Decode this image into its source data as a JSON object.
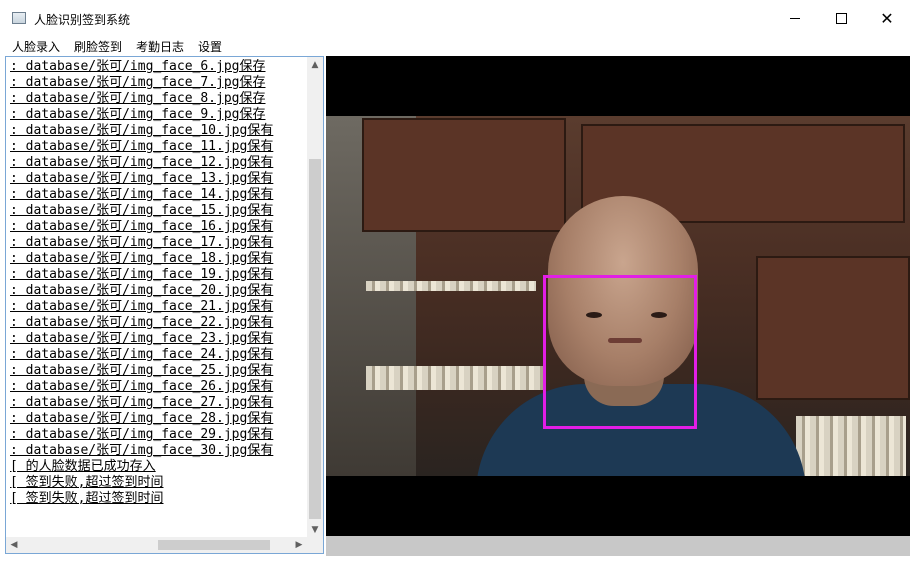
{
  "window": {
    "title": "人脸识别签到系统",
    "minimize_glyph": "",
    "maximize_glyph": "",
    "close_glyph": "✕"
  },
  "menu": {
    "items": [
      "人脸录入",
      "刷脸签到",
      "考勤日志",
      "设置"
    ]
  },
  "log": {
    "lines": [
      ": database/张可/img_face_6.jpg保存",
      ": database/张可/img_face_7.jpg保存",
      ": database/张可/img_face_8.jpg保存",
      ": database/张可/img_face_9.jpg保存",
      ": database/张可/img_face_10.jpg保有",
      ": database/张可/img_face_11.jpg保有",
      ": database/张可/img_face_12.jpg保有",
      ": database/张可/img_face_13.jpg保有",
      ": database/张可/img_face_14.jpg保有",
      ": database/张可/img_face_15.jpg保有",
      ": database/张可/img_face_16.jpg保有",
      ": database/张可/img_face_17.jpg保有",
      ": database/张可/img_face_18.jpg保有",
      ": database/张可/img_face_19.jpg保有",
      ": database/张可/img_face_20.jpg保有",
      ": database/张可/img_face_21.jpg保有",
      ": database/张可/img_face_22.jpg保有",
      ": database/张可/img_face_23.jpg保有",
      ": database/张可/img_face_24.jpg保有",
      ": database/张可/img_face_25.jpg保有",
      ": database/张可/img_face_26.jpg保有",
      ": database/张可/img_face_27.jpg保有",
      ": database/张可/img_face_28.jpg保有",
      ": database/张可/img_face_29.jpg保有",
      ": database/张可/img_face_30.jpg保有",
      "[ 的人脸数据已成功存入",
      "[ 签到失败,超过签到时间",
      "[ 签到失败,超过签到时间"
    ]
  },
  "scrollbars": {
    "up_glyph": "▲",
    "down_glyph": "▼",
    "left_glyph": "◀",
    "right_glyph": "▶"
  },
  "colors": {
    "face_box": "#e21ee6",
    "log_border": "#7aa7d6"
  }
}
